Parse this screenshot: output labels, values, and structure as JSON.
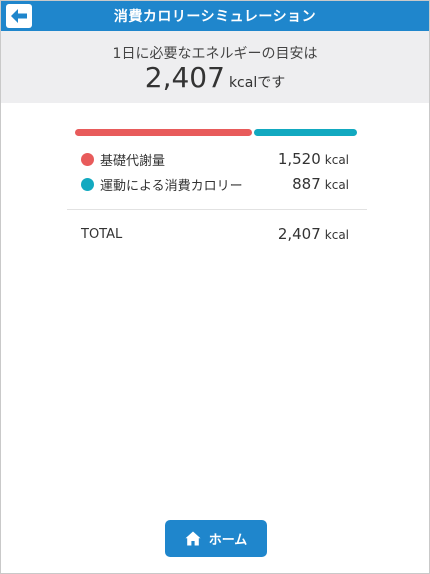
{
  "header": {
    "title": "消費カロリーシミュレーション",
    "back_icon": "back-arrow-icon"
  },
  "summary": {
    "label": "1日に必要なエネルギーの目安は",
    "value": "2,407",
    "unit": "kcalです"
  },
  "breakdown": {
    "bar": [
      {
        "name": "基礎代謝量",
        "share": 0.632,
        "color": "#e85b5b"
      },
      {
        "name": "運動による消費カロリー",
        "share": 0.368,
        "color": "#12a9c0"
      }
    ],
    "items": [
      {
        "label": "基礎代謝量",
        "value": "1,520",
        "unit": "kcal",
        "color": "#e85b5b"
      },
      {
        "label": "運動による消費カロリー",
        "value": "887",
        "unit": "kcal",
        "color": "#12a9c0"
      }
    ],
    "total": {
      "label": "TOTAL",
      "value": "2,407",
      "unit": "kcal"
    }
  },
  "footer": {
    "home_label": "ホーム",
    "home_icon": "home-icon"
  },
  "colors": {
    "accent": "#1f86cc",
    "basal": "#e85b5b",
    "exercise": "#12a9c0",
    "summary_bg": "#eeeef0"
  }
}
